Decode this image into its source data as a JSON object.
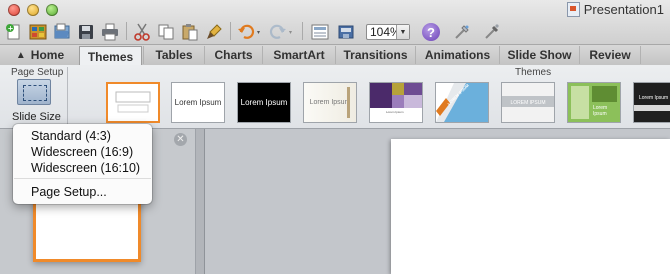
{
  "window": {
    "title": "Presentation1"
  },
  "toolbar": {
    "icons": [
      "new-icon",
      "templates-icon",
      "open-icon",
      "save-icon",
      "print-icon",
      "cut-icon",
      "copy-icon",
      "paste-icon",
      "format-painter-icon",
      "undo-icon",
      "redo-icon",
      "gallery-icon",
      "media-browser-icon",
      "help-icon",
      "toolbox-icon",
      "connector-icon"
    ],
    "zoom_value": "104%",
    "help_glyph": "?"
  },
  "tabs": [
    {
      "label": "Home",
      "active": false
    },
    {
      "label": "Themes",
      "active": true
    },
    {
      "label": "Tables",
      "active": false
    },
    {
      "label": "Charts",
      "active": false
    },
    {
      "label": "SmartArt",
      "active": false
    },
    {
      "label": "Transitions",
      "active": false
    },
    {
      "label": "Animations",
      "active": false
    },
    {
      "label": "Slide Show",
      "active": false
    },
    {
      "label": "Review",
      "active": false
    }
  ],
  "ribbon": {
    "page_setup_label": "Page Setup",
    "themes_label": "Themes",
    "slide_size_label": "Slide Size",
    "themes": [
      {
        "name": "blank",
        "text": "",
        "selected": true
      },
      {
        "name": "office-white",
        "text": "Lorem Ipsum",
        "selected": false
      },
      {
        "name": "office-black",
        "text": "Lorem Ipsum",
        "selected": false
      },
      {
        "name": "paper",
        "text": "Lorem Ipsum",
        "selected": false
      },
      {
        "name": "purple-blocks",
        "text": "Lorem Ipsum",
        "selected": false
      },
      {
        "name": "blue-diagonal",
        "text": "LOREM IPSUM",
        "selected": false
      },
      {
        "name": "gray-band",
        "text": "LOREM IPSUM",
        "selected": false
      },
      {
        "name": "green-photo",
        "text": "Lorem Ipsum",
        "selected": false
      },
      {
        "name": "dark-strip",
        "text": "Lorem Ipsum",
        "selected": false
      }
    ]
  },
  "slide_size_menu": {
    "items": [
      "Standard (4:3)",
      "Widescreen (16:9)",
      "Widescreen (16:10)",
      "Page Setup..."
    ]
  },
  "slides_pane": {
    "close_glyph": "✕",
    "slide_number": "1"
  },
  "colors": {
    "accent_selection": "#f08a2a",
    "help_purple": "#6a3fb6"
  }
}
